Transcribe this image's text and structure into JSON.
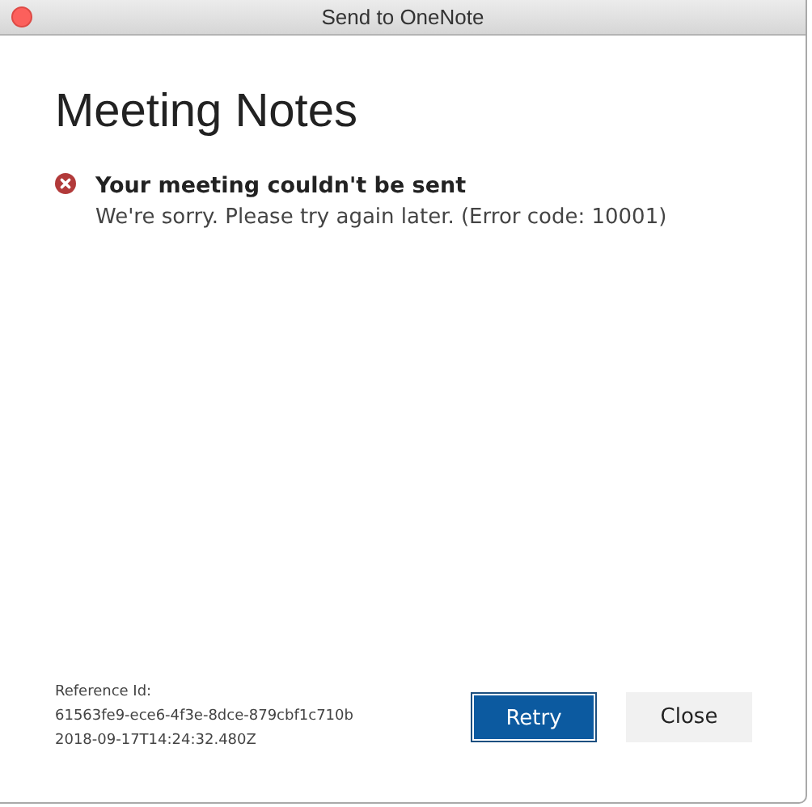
{
  "window": {
    "title": "Send to OneNote"
  },
  "heading": "Meeting Notes",
  "error": {
    "title": "Your meeting couldn't be sent",
    "message": "We're sorry. Please try again later. (Error code: 10001)"
  },
  "reference": [
    "Reference Id:",
    "61563fe9-ece6-4f3e-8dce-879cbf1c710b",
    "2018-09-17T14:24:32.480Z"
  ],
  "buttons": [
    {
      "label": "Retry",
      "kind": "primary"
    },
    {
      "label": "Close",
      "kind": "secondary"
    }
  ]
}
